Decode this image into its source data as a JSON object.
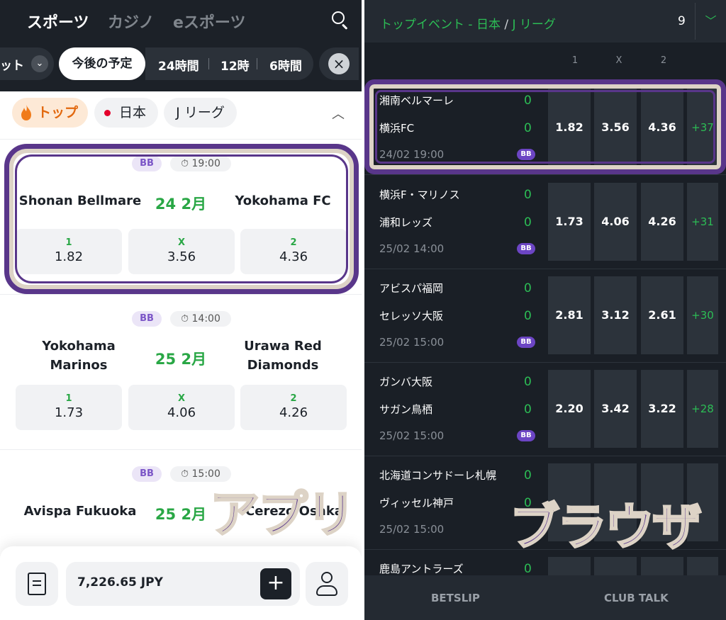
{
  "app": {
    "main_tabs": [
      "スポーツ",
      "カジノ",
      "eスポーツ"
    ],
    "filters": {
      "partial_label": "ット",
      "active": "今後の予定",
      "options": [
        "24時間",
        "12時",
        "6時間"
      ]
    },
    "breadcrumbs": [
      "トップ",
      "日本",
      "J リーグ"
    ],
    "matches": [
      {
        "bb": "BB",
        "time": "19:00",
        "home": "Shonan Bellmare",
        "date": "24 2月",
        "away": "Yokohama FC",
        "odds": [
          {
            "label": "1",
            "value": "1.82"
          },
          {
            "label": "X",
            "value": "3.56"
          },
          {
            "label": "2",
            "value": "4.36"
          }
        ]
      },
      {
        "bb": "BB",
        "time": "14:00",
        "home": "Yokohama Marinos",
        "date": "25 2月",
        "away": "Urawa Red Diamonds",
        "odds": [
          {
            "label": "1",
            "value": "1.73"
          },
          {
            "label": "X",
            "value": "4.06"
          },
          {
            "label": "2",
            "value": "4.26"
          }
        ]
      },
      {
        "bb": "BB",
        "time": "15:00",
        "home": "Avispa Fukuoka",
        "date": "25 2月",
        "away": "Cerezo Osaka"
      }
    ],
    "balance": "7,226.65 JPY",
    "overlay_label": "アプリ"
  },
  "browser": {
    "title_part1": "トップイベント - 日本",
    "title_sep": "/",
    "title_part2": "J リーグ",
    "event_count": "9",
    "columns": [
      "1",
      "X",
      "2"
    ],
    "events": [
      {
        "home": "湘南ベルマーレ",
        "away": "横浜FC",
        "home_score": "0",
        "away_score": "0",
        "time": "24/02 19:00",
        "bb": "BB",
        "odds": [
          "1.82",
          "3.56",
          "4.36"
        ],
        "more": "+37"
      },
      {
        "home": "横浜F・マリノス",
        "away": "浦和レッズ",
        "home_score": "0",
        "away_score": "0",
        "time": "25/02 14:00",
        "bb": "BB",
        "odds": [
          "1.73",
          "4.06",
          "4.26"
        ],
        "more": "+31"
      },
      {
        "home": "アビスパ福岡",
        "away": "セレッソ大阪",
        "home_score": "0",
        "away_score": "0",
        "time": "25/02 15:00",
        "bb": "BB",
        "odds": [
          "2.81",
          "3.12",
          "2.61"
        ],
        "more": "+30"
      },
      {
        "home": "ガンバ大阪",
        "away": "サガン鳥栖",
        "home_score": "0",
        "away_score": "0",
        "time": "25/02 15:00",
        "bb": "BB",
        "odds": [
          "2.20",
          "3.42",
          "3.22"
        ],
        "more": "+28"
      },
      {
        "home": "北海道コンサドーレ札幌",
        "away": "ヴィッセル神戸",
        "home_score": "0",
        "away_score": "0",
        "time": "25/02 15:00",
        "bb": "",
        "odds": [
          "",
          "",
          ""
        ],
        "more": ""
      },
      {
        "home": "鹿島アントラーズ",
        "away": "",
        "home_score": "0",
        "away_score": "",
        "time": "",
        "bb": "",
        "odds": [
          "",
          "",
          ""
        ],
        "more": ""
      }
    ],
    "bottom_tabs": [
      "BETSLIP",
      "CLUB TALK"
    ],
    "overlay_label": "ブラウザ"
  },
  "colors": {
    "accent_green": "#29a745",
    "highlight_purple": "#59368a",
    "highlight_beige": "#ddd3c6",
    "dark_bg": "#1a1f26"
  }
}
